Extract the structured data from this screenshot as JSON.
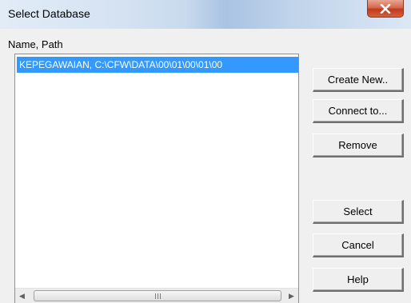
{
  "window": {
    "title": "Select Database",
    "close_icon": "close-icon"
  },
  "list": {
    "column_header": "Name, Path",
    "items": [
      {
        "text": "KEPEGAWAIAN, C:\\CFW\\DATA\\00\\01\\00\\01\\00",
        "selected": true
      }
    ],
    "selection_color": "#3399ff"
  },
  "scrollbar": {
    "left_arrow": "◀",
    "right_arrow": "▶"
  },
  "buttons": {
    "create_new": "Create New..",
    "connect_to": "Connect to...",
    "remove": "Remove",
    "select": "Select",
    "cancel": "Cancel",
    "help": "Help"
  }
}
